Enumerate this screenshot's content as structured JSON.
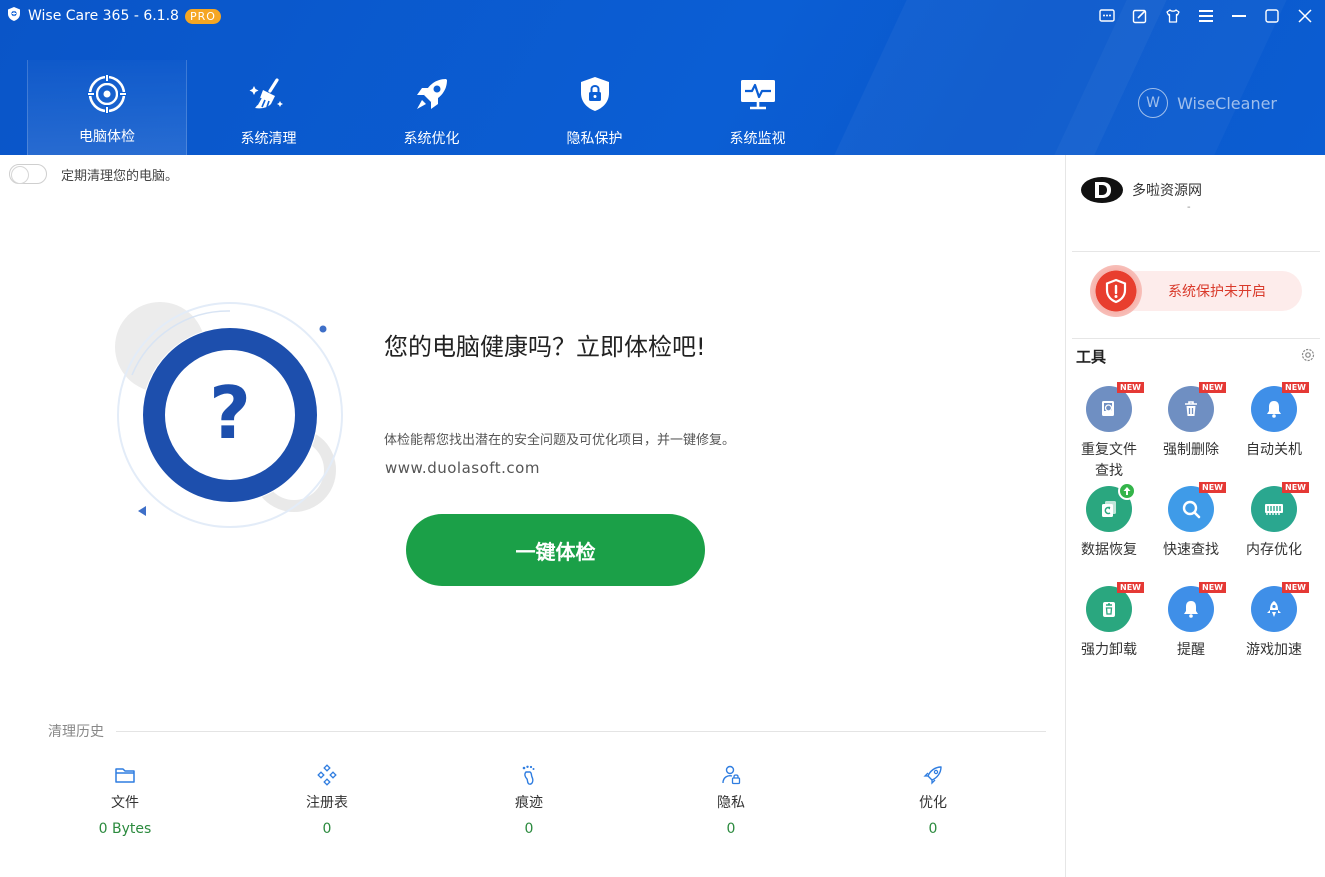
{
  "app": {
    "title": "Wise Care 365 - 6.1.8",
    "badge": "PRO"
  },
  "window_controls": [
    "feedback-icon",
    "edit-icon",
    "skin-icon",
    "menu-icon",
    "minimize-icon",
    "maximize-icon",
    "close-icon"
  ],
  "nav": {
    "tabs": [
      {
        "label": "电脑体检",
        "icon": "radar-icon",
        "active": true
      },
      {
        "label": "系统清理",
        "icon": "broom-icon",
        "active": false
      },
      {
        "label": "系统优化",
        "icon": "rocket-icon",
        "active": false
      },
      {
        "label": "隐私保护",
        "icon": "shield-lock-icon",
        "active": false
      },
      {
        "label": "系统监视",
        "icon": "monitor-icon",
        "active": false
      }
    ]
  },
  "brand": {
    "letter": "W",
    "name": "WiseCleaner"
  },
  "schedule": {
    "label": "定期清理您的电脑。",
    "enabled": false
  },
  "hero": {
    "title": "您的电脑健康吗？立即体检吧!",
    "description": "体检能帮您找出潜在的安全问题及可优化项目，并一键修复。",
    "url": "www.duolasoft.com",
    "button": "一键体检"
  },
  "history": {
    "title": "清理历史",
    "items": [
      {
        "label": "文件",
        "value": "0 Bytes",
        "icon": "folder-icon"
      },
      {
        "label": "注册表",
        "value": "0",
        "icon": "registry-icon"
      },
      {
        "label": "痕迹",
        "value": "0",
        "icon": "footprint-icon"
      },
      {
        "label": "隐私",
        "value": "0",
        "icon": "privacy-user-icon"
      },
      {
        "label": "优化",
        "value": "0",
        "icon": "rocket-outline-icon"
      }
    ]
  },
  "side": {
    "account_name": "多啦资源网",
    "account_sub": "-",
    "protection": "系统保护未开启",
    "tools_title": "工具",
    "new_label": "NEW",
    "tools": [
      {
        "label": "重复文件查找",
        "icon": "duplicate-file-icon",
        "color": "#6f8fc2",
        "badge": "new"
      },
      {
        "label": "强制删除",
        "icon": "trash-icon",
        "color": "#6f8fc2",
        "badge": "new"
      },
      {
        "label": "自动关机",
        "icon": "bell-icon",
        "color": "#3f8fe8",
        "badge": "new"
      },
      {
        "label": "数据恢复",
        "icon": "data-recovery-icon",
        "color": "#2aa77f",
        "badge": "up"
      },
      {
        "label": "快速查找",
        "icon": "search-icon",
        "color": "#3f9be8",
        "badge": "new"
      },
      {
        "label": "内存优化",
        "icon": "memory-icon",
        "color": "#2aa78f",
        "badge": "new"
      },
      {
        "label": "强力卸载",
        "icon": "uninstall-icon",
        "color": "#2aa77f",
        "badge": "new"
      },
      {
        "label": "提醒",
        "icon": "reminder-bell-icon",
        "color": "#3f8fe8",
        "badge": "new"
      },
      {
        "label": "游戏加速",
        "icon": "game-rocket-icon",
        "color": "#3f8fe8",
        "badge": "new"
      }
    ]
  },
  "colors": {
    "header": "#0b5ed4",
    "accent_green": "#1ba048",
    "danger": "#e83e2e"
  }
}
